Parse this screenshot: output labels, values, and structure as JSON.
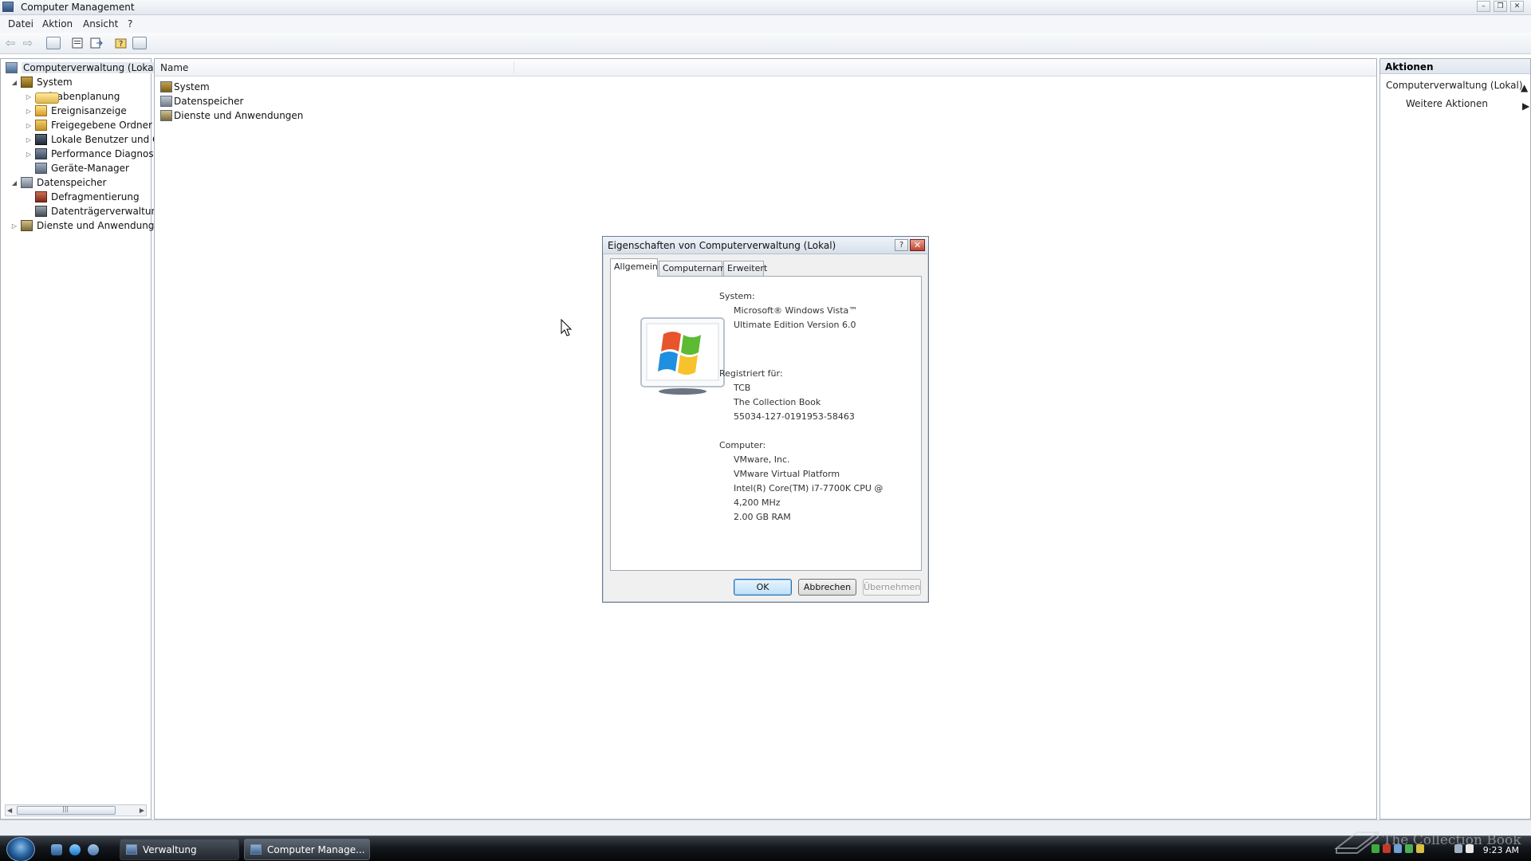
{
  "window": {
    "title": "Computer Management"
  },
  "menu": [
    "Datei",
    "Aktion",
    "Ansicht",
    "?"
  ],
  "tree": {
    "root": "Computerverwaltung (Lokal)",
    "nodes": [
      {
        "label": "System",
        "expander": "◢"
      },
      {
        "label": "Aufgabenplanung",
        "expander": "▷"
      },
      {
        "label": "Ereignisanzeige",
        "expander": "▷"
      },
      {
        "label": "Freigegebene Ordner",
        "expander": "▷"
      },
      {
        "label": "Lokale Benutzer und Gr",
        "expander": "▷"
      },
      {
        "label": "Performance Diagnostic",
        "expander": "▷"
      },
      {
        "label": "Geräte-Manager",
        "expander": ""
      },
      {
        "label": "Datenspeicher",
        "expander": "◢"
      },
      {
        "label": "Defragmentierung",
        "expander": ""
      },
      {
        "label": "Datenträgerverwaltung",
        "expander": ""
      },
      {
        "label": "Dienste und Anwendungen",
        "expander": "▷"
      }
    ]
  },
  "list": {
    "column_header": "Name",
    "rows": [
      "System",
      "Datenspeicher",
      "Dienste und Anwendungen"
    ]
  },
  "actions": {
    "header": "Aktionen",
    "section": "Computerverwaltung (Lokal)",
    "item": "Weitere Aktionen"
  },
  "dialog": {
    "title": "Eigenschaften von Computerverwaltung (Lokal)",
    "help_label": "?",
    "close_label": "✕",
    "tabs": [
      "Allgemein",
      "Computername",
      "Erweitert"
    ],
    "system_label": "System:",
    "system_lines": [
      "Microsoft® Windows Vista™",
      "Ultimate Edition Version 6.0"
    ],
    "registered_label": "Registriert für:",
    "registered_lines": [
      "TCB",
      "The Collection Book",
      "55034-127-0191953-58463"
    ],
    "computer_label": "Computer:",
    "computer_lines": [
      "VMware, Inc.",
      "VMware Virtual Platform",
      "Intel(R) Core(TM) i7-7700K CPU @",
      "4,200 MHz",
      "2.00 GB RAM"
    ],
    "buttons": {
      "ok": "OK",
      "cancel": "Abbrechen",
      "apply": "Übernehmen"
    }
  },
  "taskbar": {
    "items": [
      "Verwaltung",
      "Computer Manage..."
    ],
    "clock": "9:23 AM"
  },
  "watermark": "The Collection Book",
  "icons": {
    "app": "computer-management-icon",
    "back": "back-arrow-icon",
    "forward": "forward-arrow-icon",
    "start": "windows-orb-icon"
  },
  "colors": {
    "taskbar": "#14181d",
    "selection": "#e4e9f0",
    "ok_button": "#bfe0f9",
    "close_button": "#c04330"
  }
}
